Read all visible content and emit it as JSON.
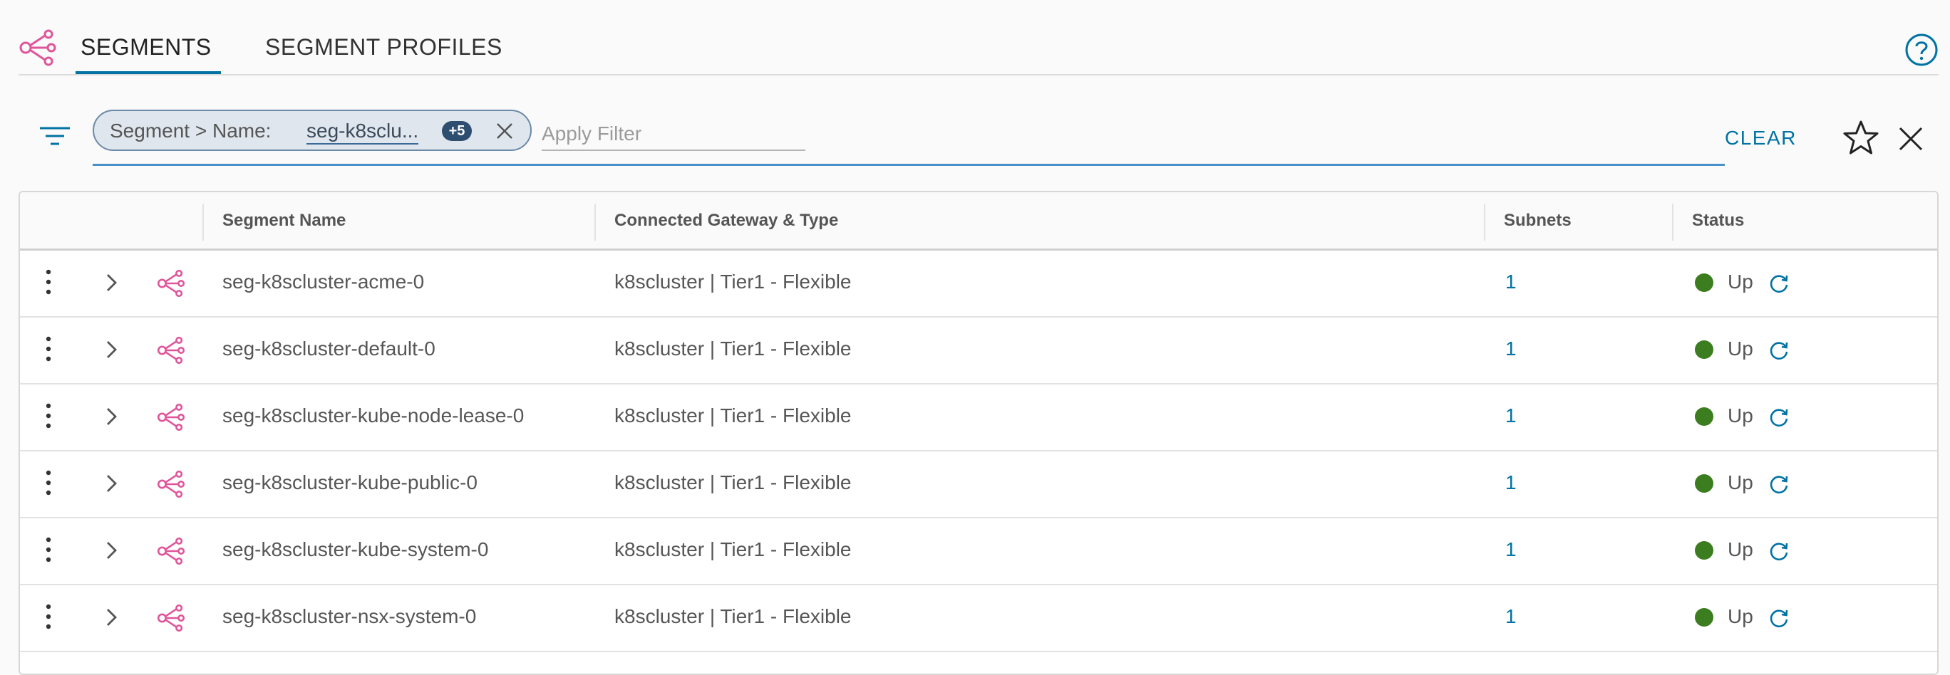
{
  "tabs": [
    {
      "label": "SEGMENTS",
      "active": true
    },
    {
      "label": "SEGMENT PROFILES",
      "active": false
    }
  ],
  "icons": {
    "segments": "segment-share-icon",
    "help": "help-circle-icon",
    "filter": "filter-lines-icon",
    "chip_remove": "close-x-icon",
    "favorite": "star-outline-icon",
    "close": "close-x-icon",
    "row_actions": "kebab-vertical-icon",
    "expand": "chevron-right-icon",
    "row_segment": "segment-share-icon",
    "refresh": "refresh-icon"
  },
  "filter": {
    "chip_label": "Segment > Name:",
    "chip_value": "seg-k8sclu...",
    "chip_count": "+5",
    "apply_placeholder": "Apply Filter",
    "clear_label": "CLEAR"
  },
  "table": {
    "headers": {
      "name": "Segment Name",
      "gateway": "Connected Gateway & Type",
      "subnets": "Subnets",
      "status": "Status"
    },
    "rows": [
      {
        "name": "seg-k8scluster-acme-0",
        "gateway": "k8scluster | Tier1 - Flexible",
        "subnets": "1",
        "status": "Up"
      },
      {
        "name": "seg-k8scluster-default-0",
        "gateway": "k8scluster | Tier1 - Flexible",
        "subnets": "1",
        "status": "Up"
      },
      {
        "name": "seg-k8scluster-kube-node-lease-0",
        "gateway": "k8scluster | Tier1 - Flexible",
        "subnets": "1",
        "status": "Up"
      },
      {
        "name": "seg-k8scluster-kube-public-0",
        "gateway": "k8scluster | Tier1 - Flexible",
        "subnets": "1",
        "status": "Up"
      },
      {
        "name": "seg-k8scluster-kube-system-0",
        "gateway": "k8scluster | Tier1 - Flexible",
        "subnets": "1",
        "status": "Up"
      },
      {
        "name": "seg-k8scluster-nsx-system-0",
        "gateway": "k8scluster | Tier1 - Flexible",
        "subnets": "1",
        "status": "Up"
      }
    ]
  },
  "colors": {
    "accent": "#0072a3",
    "segment_icon": "#e0559a",
    "status_up": "#3b7d1f"
  }
}
